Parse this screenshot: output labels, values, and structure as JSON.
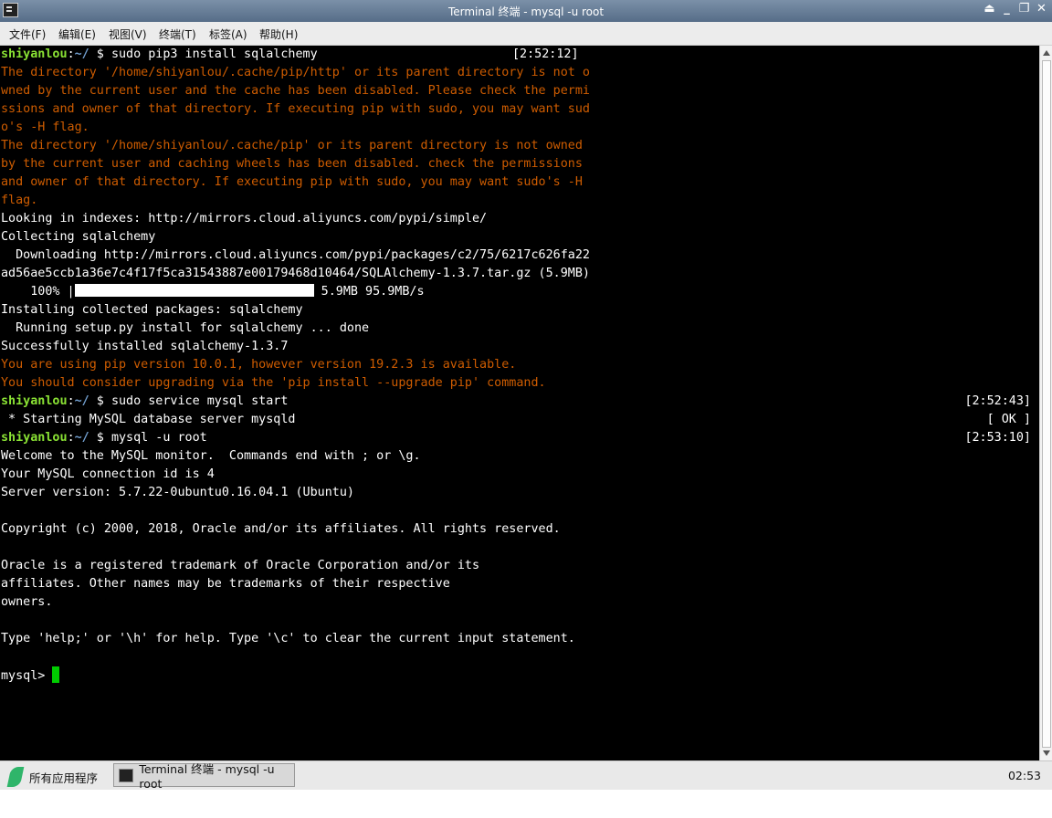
{
  "window": {
    "title": "Terminal 终端 - mysql -u root",
    "buttons": [
      "⏏",
      "_",
      "❐",
      "✕"
    ]
  },
  "menubar": {
    "items": [
      "文件(F)",
      "编辑(E)",
      "视图(V)",
      "终端(T)",
      "标签(A)",
      "帮助(H)"
    ]
  },
  "terminal": {
    "user_host": "shiyanlou",
    "path": "~/",
    "prompt_symbol": " $ ",
    "cmd1": "sudo pip3 install sqlalchemy",
    "time1": "[2:52:12]",
    "warn1": [
      "The directory '/home/shiyanlou/.cache/pip/http' or its parent directory is not o",
      "wned by the current user and the cache has been disabled. Please check the permi",
      "ssions and owner of that directory. If executing pip with sudo, you may want sud",
      "o's -H flag.",
      "The directory '/home/shiyanlou/.cache/pip' or its parent directory is not owned",
      "by the current user and caching wheels has been disabled. check the permissions",
      "and owner of that directory. If executing pip with sudo, you may want sudo's -H",
      "flag."
    ],
    "out1": [
      "Looking in indexes: http://mirrors.cloud.aliyuncs.com/pypi/simple/",
      "Collecting sqlalchemy",
      "  Downloading http://mirrors.cloud.aliyuncs.com/pypi/packages/c2/75/6217c626fa22",
      "ad56ae5ccb1a36e7c4f17f5ca31543887e00179468d10464/SQLAlchemy-1.3.7.tar.gz (5.9MB)"
    ],
    "progress": {
      "percent_label": "    100% |",
      "fraction": 1.0,
      "suffix": " 5.9MB 95.9MB/s"
    },
    "out2": [
      "Installing collected packages: sqlalchemy",
      "  Running setup.py install for sqlalchemy ... done",
      "Successfully installed sqlalchemy-1.3.7"
    ],
    "warn2": [
      "You are using pip version 10.0.1, however version 19.2.3 is available.",
      "You should consider upgrading via the 'pip install --upgrade pip' command."
    ],
    "cmd2": "sudo service mysql start",
    "time2": "[2:52:43]",
    "service_out": " * Starting MySQL database server mysqld",
    "service_status": "[ OK ]",
    "cmd3": "mysql -u root",
    "time3": "[2:53:10]",
    "mysql_out": [
      "Welcome to the MySQL monitor.  Commands end with ; or \\g.",
      "Your MySQL connection id is 4",
      "Server version: 5.7.22-0ubuntu0.16.04.1 (Ubuntu)",
      "",
      "Copyright (c) 2000, 2018, Oracle and/or its affiliates. All rights reserved.",
      "",
      "Oracle is a registered trademark of Oracle Corporation and/or its",
      "affiliates. Other names may be trademarks of their respective",
      "owners.",
      "",
      "Type 'help;' or '\\h' for help. Type '\\c' to clear the current input statement.",
      ""
    ],
    "mysql_prompt": "mysql> "
  },
  "taskbar": {
    "start_label": "所有应用程序",
    "task_label": "Terminal 终端 - mysql -u root",
    "clock": "02:53"
  },
  "colors": {
    "prompt_user": "#8ae234",
    "prompt_path": "#729fcf",
    "warning": "#ce5c00",
    "cursor": "#00cc00"
  }
}
